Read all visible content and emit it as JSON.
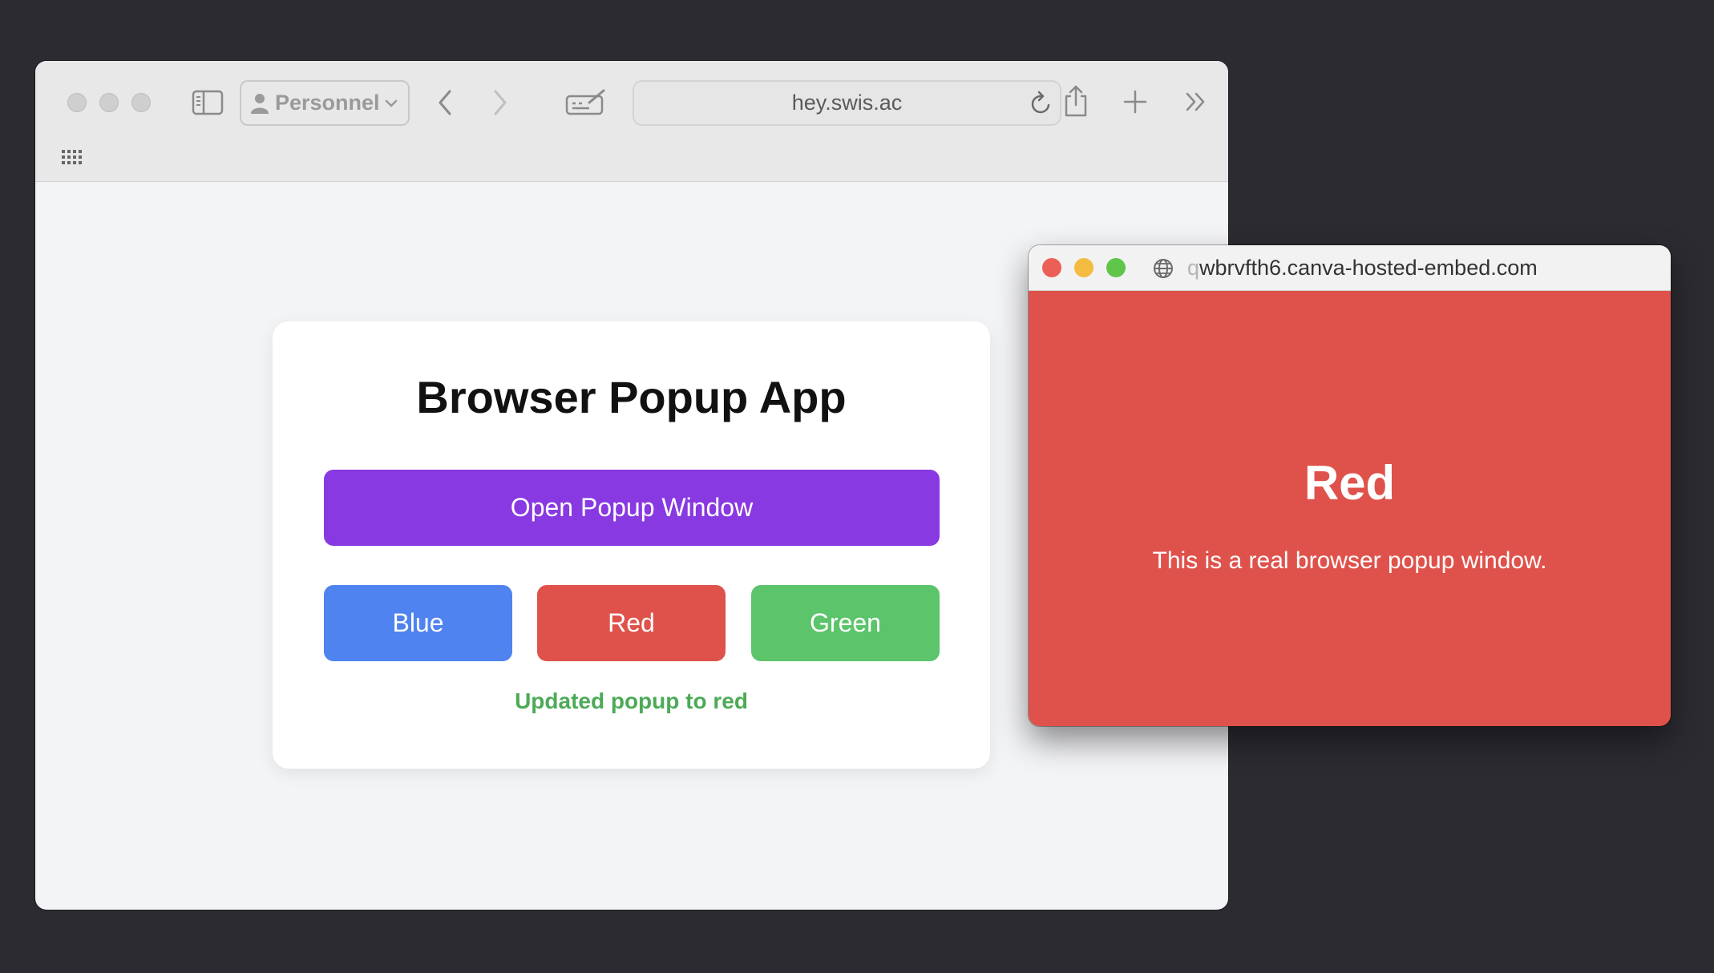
{
  "browser": {
    "profile_label": "Personnel",
    "address": "hey.swis.ac",
    "icons": {
      "sidebar": "sidebar-icon",
      "profile": "person-icon",
      "back": "chevron-left-icon",
      "forward": "chevron-right-icon",
      "edit": "compose-icon",
      "reload": "reload-icon",
      "share": "share-icon",
      "new_tab": "plus-icon",
      "more": "double-chevron-icon",
      "apps": "grid-icon"
    }
  },
  "card": {
    "title": "Browser Popup App",
    "open_button": "Open Popup Window",
    "color_buttons": {
      "blue": "Blue",
      "red": "Red",
      "green": "Green"
    },
    "status": "Updated popup to red"
  },
  "popup": {
    "url_faded": "q",
    "url_main": "wbrvfth6.canva-hosted-embed.com",
    "title": "Red",
    "message": "This is a real browser popup window."
  },
  "colors": {
    "purple": "#8839e1",
    "blue": "#4f83ef",
    "red": "#df524b",
    "green": "#5cc46b",
    "status_green": "#4caa57"
  }
}
